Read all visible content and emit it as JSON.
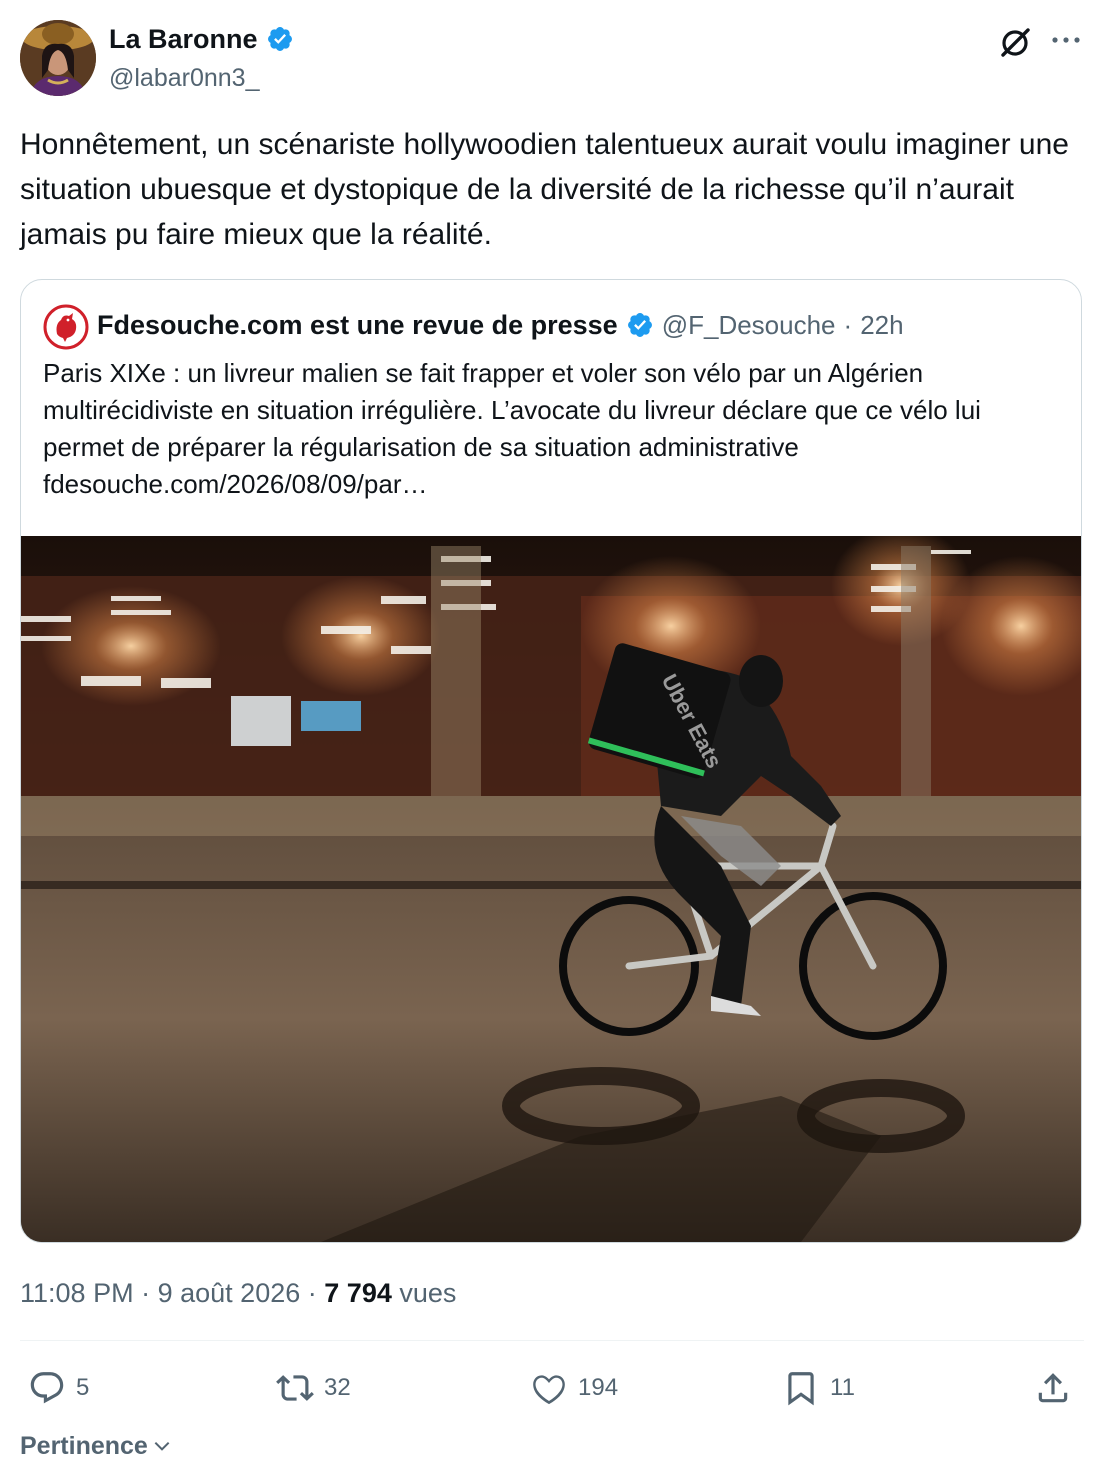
{
  "author": {
    "display_name": "La Baronne",
    "handle": "@labar0nn3_",
    "verified": true
  },
  "tweet": {
    "text": "Honnêtement, un scénariste hollywoodien talentueux aurait voulu imaginer une situation ubuesque et dystopique de la diversité de la richesse qu’il n’aurait jamais pu faire mieux que la réalité."
  },
  "quote": {
    "display_name": "Fdesouche.com est une revue de presse",
    "handle": "@F_Desouche",
    "separator": "·",
    "time": "22h",
    "text": "Paris XIXe : un livreur malien se fait frapper et voler son vélo par un Algérien multirécidiviste en situation irrégulière. L’avocate du livreur déclare que ce vélo lui permet de préparer la régularisation de sa situation administrative fdesouche.com/2026/08/09/par…",
    "bag_text": "Uber Eats"
  },
  "meta": {
    "time": "11:08 PM",
    "sep1": "·",
    "date": "9 août 2026",
    "sep2": "·",
    "views": "7 794",
    "views_label": "vues"
  },
  "actions": {
    "replies": "5",
    "reposts": "32",
    "likes": "194",
    "bookmarks": "11"
  },
  "sort": {
    "label": "Pertinence"
  },
  "colors": {
    "verified": "#1d9bf0",
    "text": "#0f1419",
    "secondary": "#536471",
    "border": "#cfd9de",
    "quote_avatar": "#d0202a"
  }
}
